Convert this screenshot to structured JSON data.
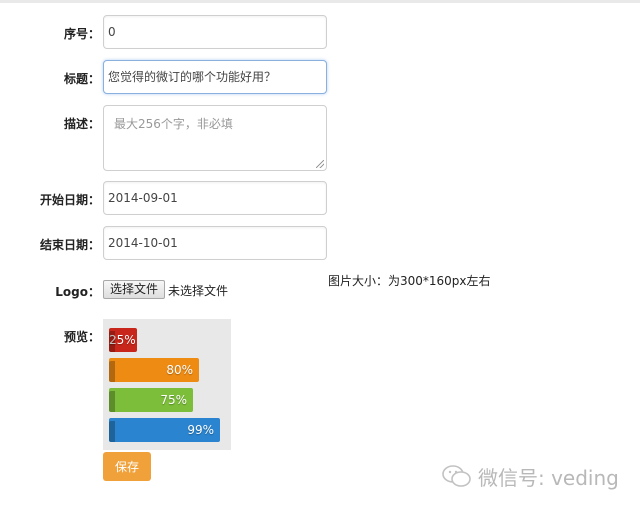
{
  "form": {
    "serial": {
      "label": "序号：",
      "value": "0"
    },
    "title": {
      "label": "标题：",
      "value": "您觉得的微订的哪个功能好用？"
    },
    "description": {
      "label": "描述：",
      "placeholder": "最大256个字，非必填"
    },
    "start_date": {
      "label": "开始日期：",
      "value": "2014-09-01"
    },
    "end_date": {
      "label": "结束日期：",
      "value": "2014-10-01"
    },
    "logo": {
      "label": "Logo：",
      "button": "选择文件",
      "status": "未选择文件",
      "hint": "图片大小：为300*160px左右"
    },
    "preview": {
      "label": "预览："
    },
    "save_label": "保存"
  },
  "preview_bars": [
    {
      "label": "25%",
      "percent": 25,
      "color": "#c8261a"
    },
    {
      "label": "80%",
      "percent": 80,
      "color": "#ee8b13"
    },
    {
      "label": "75%",
      "percent": 75,
      "color": "#7cbd3a"
    },
    {
      "label": "99%",
      "percent": 99,
      "color": "#2a84cf"
    }
  ],
  "watermark": {
    "text": "微信号: veding"
  }
}
